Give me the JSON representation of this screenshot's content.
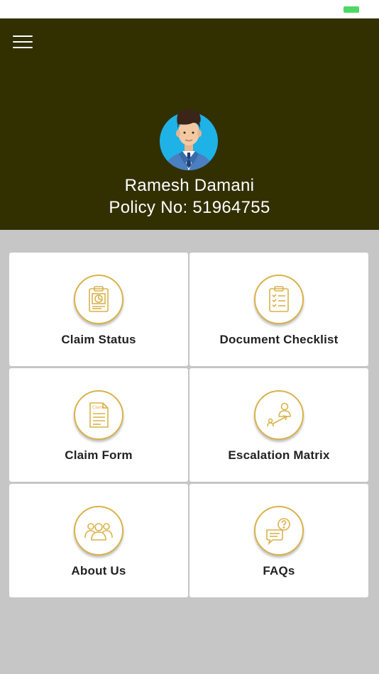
{
  "colors": {
    "header_bg": "#323000",
    "page_bg": "#c6c6c6",
    "accent_gold": "#d9b24a",
    "battery_green": "#4cd964"
  },
  "header": {
    "menu_icon": "hamburger-icon",
    "avatar_icon": "businessman-avatar",
    "user_name": "Ramesh Damani",
    "policy_text": "Policy No: 51964755"
  },
  "tiles": [
    {
      "label": "Claim Status",
      "icon": "clipboard-chart-icon"
    },
    {
      "label": "Document Checklist",
      "icon": "checklist-icon"
    },
    {
      "label": "Claim Form",
      "icon": "claim-document-icon",
      "icon_text": "Claim"
    },
    {
      "label": "Escalation Matrix",
      "icon": "escalation-person-arrow-icon"
    },
    {
      "label": "About Us",
      "icon": "people-group-icon"
    },
    {
      "label": "FAQs",
      "icon": "chat-question-icon"
    }
  ]
}
